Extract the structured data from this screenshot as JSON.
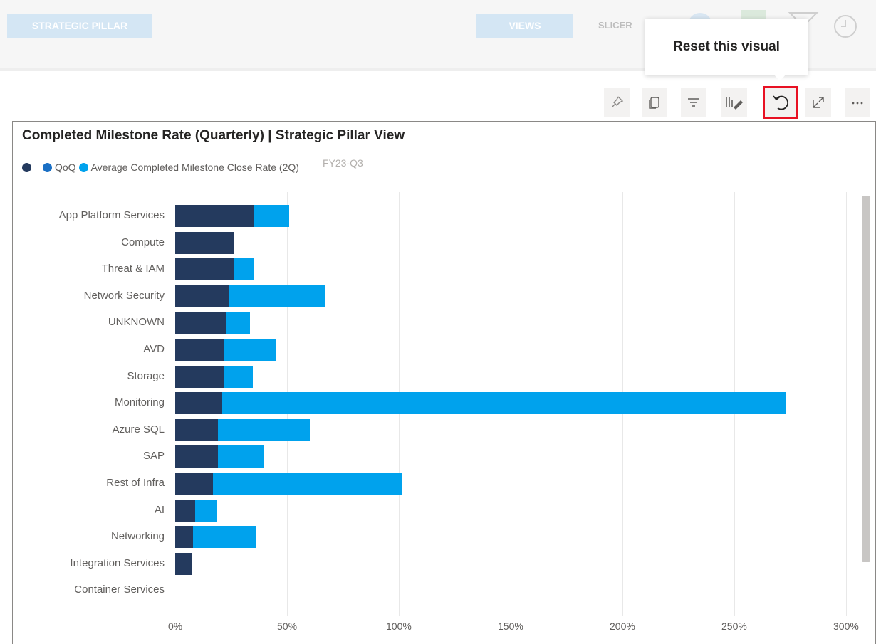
{
  "topbar": {
    "strategic_pillar": "STRATEGIC PILLAR",
    "views": "VIEWS",
    "slicers": "SLICER"
  },
  "tooltip": {
    "text": "Reset this visual"
  },
  "header_icons": [
    {
      "name": "pin-icon",
      "glyph": "⚲"
    },
    {
      "name": "copy-icon",
      "glyph": "⧉"
    },
    {
      "name": "filter-icon",
      "glyph": "≡"
    },
    {
      "name": "format-icon",
      "glyph": "⫼"
    },
    {
      "name": "reset-icon",
      "glyph": "↺"
    },
    {
      "name": "focus-mode-icon",
      "glyph": "⤢"
    },
    {
      "name": "more-options-icon",
      "glyph": "⋯"
    }
  ],
  "visual": {
    "title": "Completed Milestone Rate (Quarterly) | Strategic Pillar View",
    "legend": {
      "items": [
        "",
        "QoQ",
        "Average Completed Milestone Close Rate (2Q)"
      ],
      "colors": [
        "#243a5e",
        "#1a6fc4",
        "#00a2ed"
      ],
      "faint_label": "FY23-Q3"
    }
  },
  "chart_data": {
    "type": "bar",
    "orientation": "horizontal",
    "stacked": true,
    "categories": [
      "App Platform Services",
      "Compute",
      "Threat & IAM",
      "Network Security",
      "UNKNOWN",
      "AVD",
      "Storage",
      "Monitoring",
      "Azure SQL",
      "SAP",
      "Rest of Infra",
      "AI",
      "Networking",
      "Integration Services",
      "Container Services"
    ],
    "series": [
      {
        "name": "",
        "color": "#243a5e",
        "values": [
          35,
          26,
          26,
          24,
          23,
          22,
          21.5,
          21,
          19,
          19,
          17,
          9,
          8,
          7.5,
          0
        ]
      },
      {
        "name": "Average Completed Milestone Close Rate (2Q)",
        "color": "#00a2ed",
        "values": [
          16,
          0,
          9,
          43,
          10.5,
          23,
          13,
          252,
          41,
          20.5,
          84.5,
          10,
          28,
          0,
          0
        ]
      }
    ],
    "xlim": [
      0,
      300
    ],
    "xticks": [
      "0%",
      "50%",
      "100%",
      "150%",
      "200%",
      "250%",
      "300%"
    ],
    "grid": true,
    "legend_position": "top-left"
  }
}
